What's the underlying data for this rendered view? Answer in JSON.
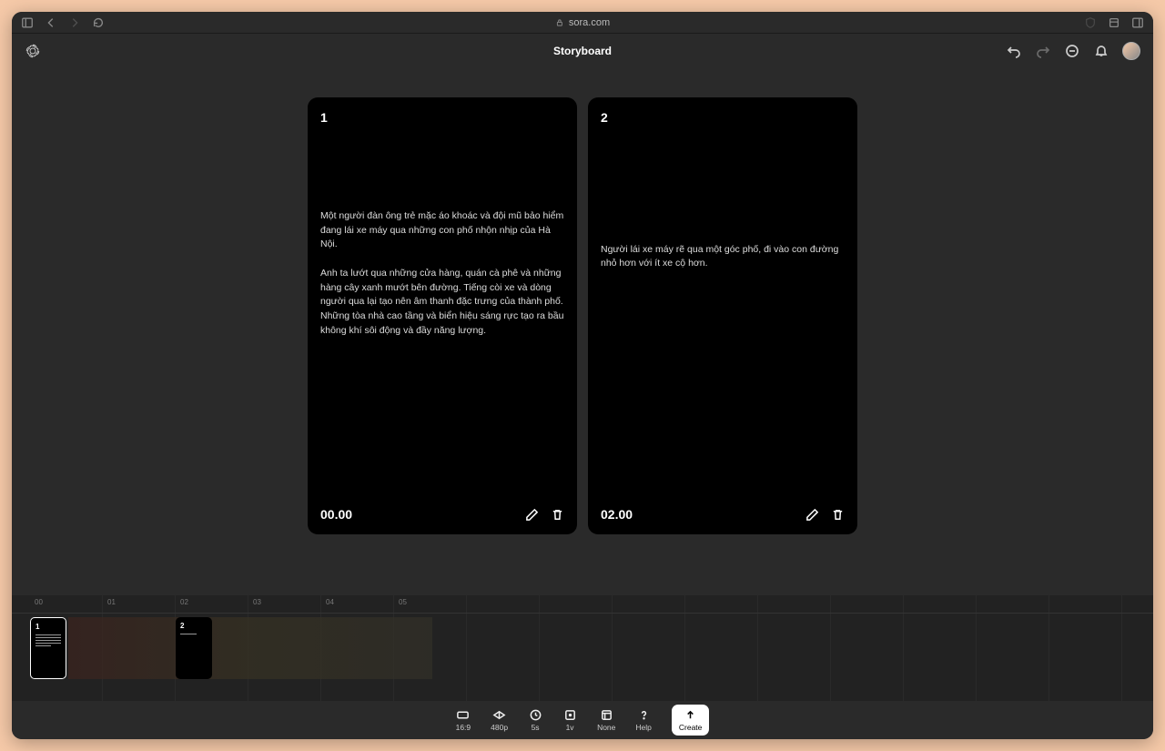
{
  "browser": {
    "url": "sora.com"
  },
  "header": {
    "title": "Storyboard"
  },
  "cards": [
    {
      "num": "1",
      "text": "Một người đàn ông trẻ mặc áo khoác và đội mũ bảo hiểm đang lái xe máy qua những con phố nhộn nhịp của Hà Nội.\n\nAnh ta lướt qua những cửa hàng, quán cà phê và những hàng cây xanh mướt bên đường. Tiếng còi xe và dòng người qua lại tạo nên âm thanh đặc trưng của thành phố. Những tòa nhà cao tầng và biển hiệu sáng rực tạo ra bầu không khí sôi động và đầy năng lượng.",
      "time": "00.00"
    },
    {
      "num": "2",
      "text": "Người lái xe máy rẽ qua một góc phố, đi vào con đường nhỏ hơn với ít xe cộ hơn.",
      "time": "02.00"
    }
  ],
  "timeline": {
    "ticks": [
      "00",
      "01",
      "02",
      "03",
      "04",
      "05"
    ],
    "clips": [
      {
        "num": "1"
      },
      {
        "num": "2"
      }
    ]
  },
  "toolbar": {
    "aspect": "16:9",
    "resolution": "480p",
    "duration": "5s",
    "variations": "1v",
    "style": "None",
    "help": "Help",
    "create": "Create"
  }
}
